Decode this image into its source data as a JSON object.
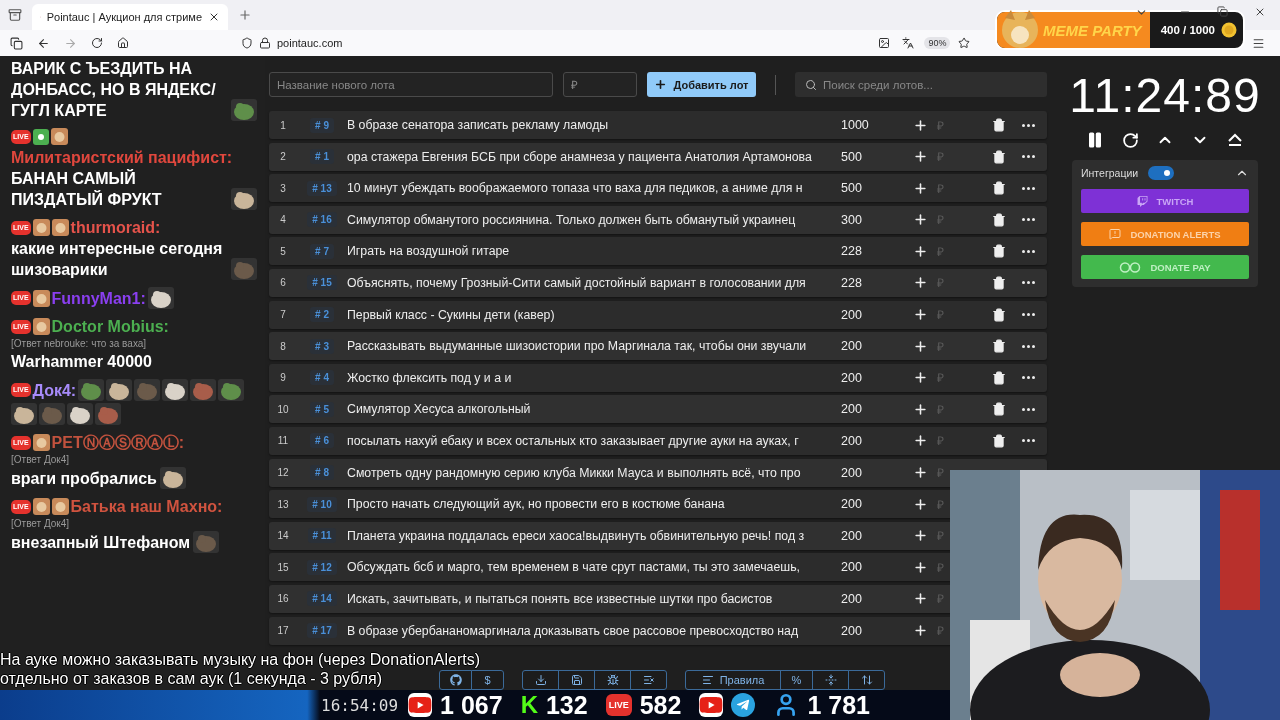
{
  "browser": {
    "tab_title": "Pointauc | Аукцион для стриме",
    "url": "pointauc.com",
    "zoom": "90%"
  },
  "overlay_widget": {
    "title": "MEME PARTY",
    "counter": "400 / 1000"
  },
  "chat": {
    "messages": [
      {
        "text": "ВАРИК С ЪЕЗДИТЬ НА ДОНБАСС, НО В ЯНДЕКС/ ГУГЛ КАРТЕ",
        "emotes": [
          {
            "kind": "picture"
          }
        ]
      },
      {
        "badges": [
          {
            "kind": "live",
            "label": "LIVE"
          },
          {
            "kind": "sub"
          },
          {
            "kind": "picture"
          }
        ],
        "user": "Милитаристский пацифист:",
        "color": "#e0473d",
        "text": "БАНАН САМЫЙ ПИЗДАТЫЙ ФРУКТ",
        "emotes": [
          {
            "kind": "picture"
          }
        ]
      },
      {
        "badges": [
          {
            "kind": "live",
            "label": "LIVE"
          },
          {
            "kind": "picture"
          },
          {
            "kind": "picture"
          }
        ],
        "user": "thurmoraid:",
        "color": "#e5534b",
        "text": "какие интересные сегодня шизоварики",
        "emotes": [
          {
            "kind": "picture"
          }
        ]
      },
      {
        "badges": [
          {
            "kind": "live",
            "label": "LIVE"
          },
          {
            "kind": "picture"
          }
        ],
        "user": "FunnyMan1:",
        "color": "#8a3ff0",
        "emotes": [
          {
            "kind": "picture"
          }
        ]
      },
      {
        "badges": [
          {
            "kind": "live",
            "label": "LIVE"
          },
          {
            "kind": "picture"
          }
        ],
        "user": "Doctor Mobius:",
        "color": "#4caf50",
        "reply": "[Ответ nebrouke: что за ваха]",
        "text": "Warhammer 40000"
      },
      {
        "badges": [
          {
            "kind": "live",
            "label": "LIVE"
          }
        ],
        "user": "Док4:",
        "color": "#a78bfa",
        "emotes": [
          {
            "kind": "picture"
          },
          {
            "kind": "picture"
          },
          {
            "kind": "picture"
          },
          {
            "kind": "picture"
          },
          {
            "kind": "picture"
          },
          {
            "kind": "picture"
          },
          {
            "kind": "picture"
          },
          {
            "kind": "picture"
          },
          {
            "kind": "picture"
          },
          {
            "kind": "picture"
          }
        ]
      },
      {
        "badges": [
          {
            "kind": "live",
            "label": "LIVE"
          },
          {
            "kind": "picture"
          }
        ],
        "user": "PETⓃⒶⓈⓇⒶⓁ:",
        "color": "#c2523e",
        "reply": "[Ответ Док4]",
        "text": "враги пробрались",
        "emotes": [
          {
            "kind": "picture"
          }
        ]
      },
      {
        "badges": [
          {
            "kind": "live",
            "label": "LIVE"
          },
          {
            "kind": "picture"
          },
          {
            "kind": "picture"
          }
        ],
        "user": "Батька наш Махно:",
        "color": "#d0533f",
        "reply": "[Ответ Док4]",
        "text": "внезапный Штефаном",
        "emotes": [
          {
            "kind": "picture"
          }
        ]
      }
    ]
  },
  "auction": {
    "new_lot_placeholder": "Название нового лота",
    "amount_placeholder": "₽",
    "add_button": "Добавить лот",
    "search_placeholder": "Поиск среди лотов...",
    "lots": [
      {
        "n": "1",
        "id": "# 9",
        "name": "В образе сенатора записать рекламу ламоды",
        "amount": "1000",
        "currency": "₽",
        "actions": [
          {
            "kind": "delete"
          },
          {
            "kind": "more"
          }
        ]
      },
      {
        "n": "2",
        "id": "# 1",
        "name": "ора стажера Евгения БСБ при сборе анамнеза у пациента Анатолия Артамонова",
        "amount": "500",
        "currency": "₽",
        "actions": [
          {
            "kind": "delete"
          },
          {
            "kind": "more"
          }
        ]
      },
      {
        "n": "3",
        "id": "# 13",
        "name": "10 минут убеждать воображаемого топаза что ваха для педиков, а аниме для н",
        "amount": "500",
        "currency": "₽",
        "actions": [
          {
            "kind": "delete"
          },
          {
            "kind": "more"
          }
        ]
      },
      {
        "n": "4",
        "id": "# 16",
        "name": "Симулятор обманутого россиянина. Только должен быть обманутый украинец",
        "amount": "300",
        "currency": "₽",
        "actions": [
          {
            "kind": "delete"
          },
          {
            "kind": "more"
          }
        ]
      },
      {
        "n": "5",
        "id": "# 7",
        "name": "Играть на воздушной гитаре",
        "amount": "228",
        "currency": "₽",
        "actions": [
          {
            "kind": "delete"
          },
          {
            "kind": "more"
          }
        ]
      },
      {
        "n": "6",
        "id": "# 15",
        "name": "Объяснять, почему Грозный-Сити самый достойный вариант в голосовании для",
        "amount": "228",
        "currency": "₽",
        "actions": [
          {
            "kind": "delete"
          },
          {
            "kind": "more"
          }
        ]
      },
      {
        "n": "7",
        "id": "# 2",
        "name": "Первый класс - Сукины дети (кавер)",
        "amount": "200",
        "currency": "₽",
        "actions": [
          {
            "kind": "delete"
          },
          {
            "kind": "more"
          }
        ]
      },
      {
        "n": "8",
        "id": "# 3",
        "name": "Рассказывать выдуманные шизоистории про Маргинала так, чтобы они звучали",
        "amount": "200",
        "currency": "₽",
        "actions": [
          {
            "kind": "delete"
          },
          {
            "kind": "more"
          }
        ]
      },
      {
        "n": "9",
        "id": "# 4",
        "name": "Жостко флексить под у и а и",
        "amount": "200",
        "currency": "₽",
        "actions": [
          {
            "kind": "delete"
          },
          {
            "kind": "more"
          }
        ]
      },
      {
        "n": "10",
        "id": "# 5",
        "name": "Симулятор Хесуса алкогольный",
        "amount": "200",
        "currency": "₽",
        "actions": [
          {
            "kind": "delete"
          },
          {
            "kind": "more"
          }
        ]
      },
      {
        "n": "11",
        "id": "# 6",
        "name": "посылать нахуй ебаку и всех остальных кто заказывает другие ауки на ауках, г",
        "amount": "200",
        "currency": "₽",
        "actions": [
          {
            "kind": "delete"
          },
          {
            "kind": "more"
          }
        ]
      },
      {
        "n": "12",
        "id": "# 8",
        "name": "Смотреть одну рандомную серию клуба Микки Мауса и выполнять всё, что про",
        "amount": "200",
        "currency": "₽"
      },
      {
        "n": "13",
        "id": "# 10",
        "name": "Просто начать следующий аук, но провести его в костюме банана",
        "amount": "200",
        "currency": "₽"
      },
      {
        "n": "14",
        "id": "# 11",
        "name": "Планета украина поддалась ереси хаоса!выдвинуть обвинительную речь! под з",
        "amount": "200",
        "currency": "₽"
      },
      {
        "n": "15",
        "id": "# 12",
        "name": "Обсуждать бсб и марго, тем временем в чате срут пастами, ты это замечаешь,",
        "amount": "200",
        "currency": "₽"
      },
      {
        "n": "16",
        "id": "# 14",
        "name": "Искать, зачитывать, и пытаться понять все известные шутки про басистов",
        "amount": "200",
        "currency": "₽"
      },
      {
        "n": "17",
        "id": "# 17",
        "name": "В образе убербананомаргинала доказывать свое рассовое превосходство над",
        "amount": "200",
        "currency": "₽"
      }
    ],
    "footer": [
      [
        {
          "kind": "github"
        },
        {
          "kind": "text",
          "label": "$"
        }
      ],
      [
        {
          "kind": "download"
        },
        {
          "kind": "save"
        },
        {
          "kind": "bug"
        },
        {
          "kind": "clear"
        }
      ],
      [
        {
          "kind": "rules",
          "label": "Правила"
        },
        {
          "kind": "text",
          "label": "%"
        },
        {
          "kind": "split"
        },
        {
          "kind": "sort"
        }
      ]
    ]
  },
  "timer": {
    "time": "11:24:89"
  },
  "integrations": {
    "label": "Интеграции",
    "enabled": true,
    "expanded": true,
    "buttons": [
      {
        "kind": "twitch",
        "label": "TWITCH"
      },
      {
        "kind": "donationalerts",
        "label": "DONATION ALERTS"
      },
      {
        "kind": "donatepay",
        "label": "DONATE PAY"
      }
    ]
  },
  "caption": {
    "lines": [
      "На ауке можно заказывать музыку на фон (через DonationAlerts)",
      "отдельно от заказов в сам аук (1 секунда - 3 рубля)"
    ]
  },
  "stats": {
    "time": "16:54:09",
    "items": [
      {
        "kind": "youtube",
        "value": "1 067"
      },
      {
        "kind": "kick",
        "label": "K",
        "value": "132"
      },
      {
        "kind": "live",
        "label": "LIVE",
        "value": "582"
      },
      {
        "kind": "youtube"
      },
      {
        "kind": "telegram"
      },
      {
        "kind": "viewers",
        "value": "1 781"
      }
    ]
  },
  "webcam": {
    "kind": "picture"
  }
}
